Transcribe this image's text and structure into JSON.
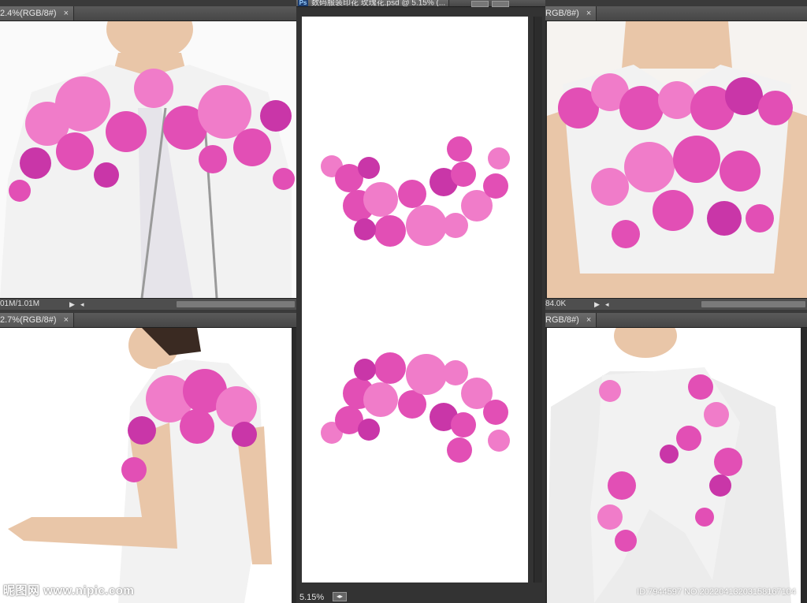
{
  "panels": {
    "top_left": {
      "tab_label": "2.4%(RGB/8#)",
      "status_size": "01M/1.01M"
    },
    "bottom_left": {
      "tab_label": "2.7%(RGB/8#)",
      "watermark": "昵图网 www.nipic.com"
    },
    "center": {
      "tab_label": "数码服装印花 玫瑰花.psd @ 5.15% (...",
      "zoom": "5.15%"
    },
    "top_right": {
      "tab_label": "RGB/8#)",
      "status_size": "84.0K"
    },
    "bottom_right": {
      "tab_label": "RGB/8#)",
      "id_mark": "ID:7944597 NO:20220413203158167104"
    }
  },
  "icons": {
    "close": "×",
    "ps_logo": "Ps",
    "arrow_right": "▶",
    "arrow_left": "◂"
  },
  "colors": {
    "rose_pink": "#e24fb5",
    "rose_light": "#f07cc9",
    "rose_deep": "#c936a8",
    "ui_dark": "#2a2a2a"
  }
}
